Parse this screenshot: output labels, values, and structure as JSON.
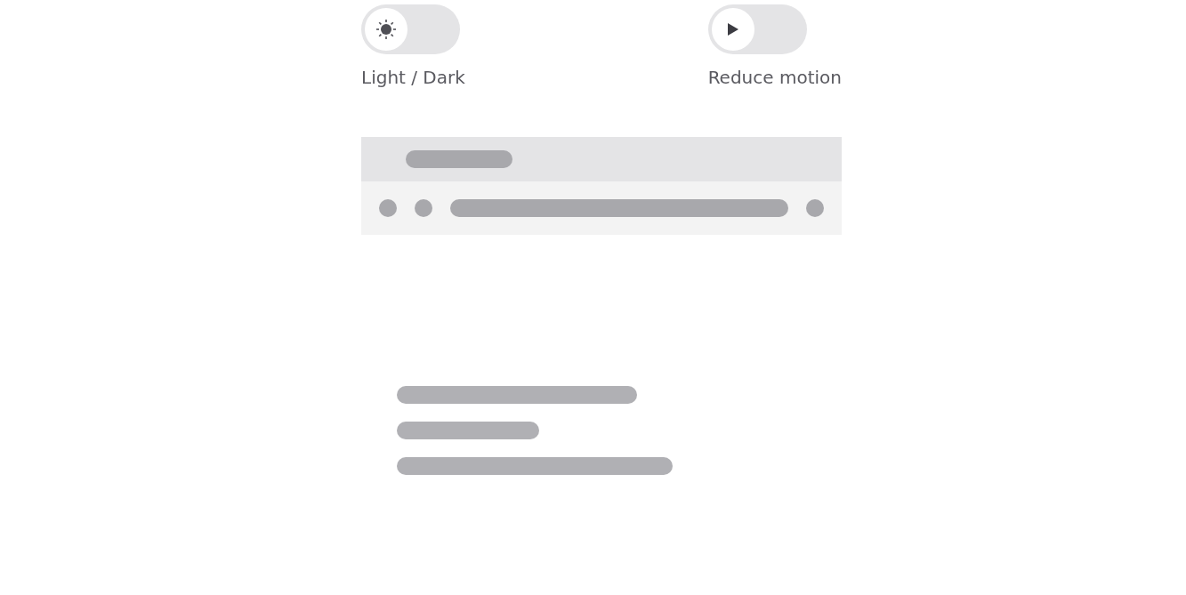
{
  "toggles": [
    {
      "kind": "theme",
      "label": "Light / Dark",
      "on": false
    },
    {
      "kind": "motion",
      "label": "Reduce motion",
      "on": false
    }
  ]
}
